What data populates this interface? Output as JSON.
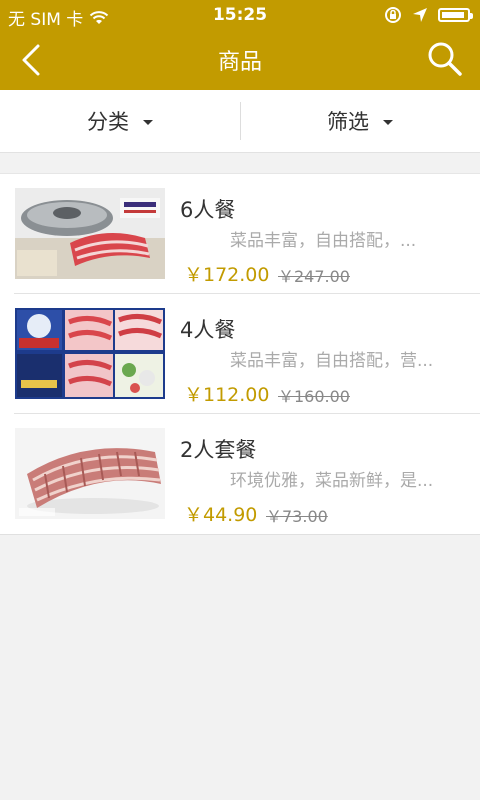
{
  "status_bar": {
    "carrier": "无 SIM 卡",
    "time": "15:25",
    "battery_level": 0.9
  },
  "header": {
    "title": "商品",
    "back_icon": "chevron-left-icon",
    "search_icon": "search-icon"
  },
  "filters": {
    "category_label": "分类",
    "filter_label": "筛选"
  },
  "products": [
    {
      "name": "6人餐",
      "description": "菜品丰富，自由搭配，...",
      "price": "￥172.00",
      "original_price": "￥247.00"
    },
    {
      "name": "4人餐",
      "description": "菜品丰富，自由搭配，营...",
      "price": "￥112.00",
      "original_price": "￥160.00"
    },
    {
      "name": "2人套餐",
      "description": "环境优雅，菜品新鲜，是...",
      "price": "￥44.90",
      "original_price": "￥73.00"
    }
  ],
  "colors": {
    "brand": "#c29b00",
    "price": "#c29b00"
  }
}
